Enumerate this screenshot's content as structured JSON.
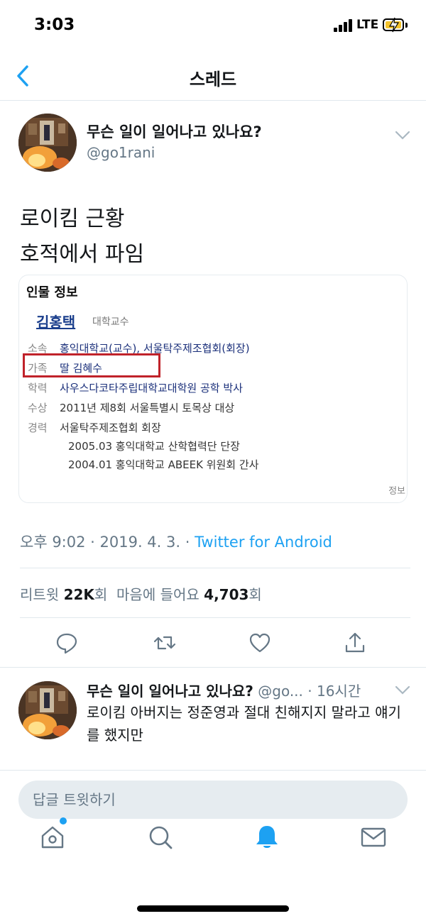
{
  "status_bar": {
    "time": "3:03",
    "network": "LTE"
  },
  "header": {
    "title": "스레드"
  },
  "tweet": {
    "author_name": "무슨 일이 일어나고 있나요?",
    "author_handle": "@go1rani",
    "text_line1": "로이킴 근황",
    "text_line2": "호적에서 파임",
    "timestamp": "오후 9:02 · 2019. 4. 3. · ",
    "source": "Twitter for Android",
    "retweets_label": "리트윗 ",
    "retweets_count": "22K",
    "retweets_unit": "회",
    "likes_label": "마음에 들어요 ",
    "likes_count": "4,703",
    "likes_unit": "회"
  },
  "card": {
    "title": "인물 정보",
    "name": "김홍택",
    "job": "대학교수",
    "rows": [
      {
        "label": "소속",
        "value": "홍익대학교(교수), 서울탁주제조협회(회장)"
      },
      {
        "label": "가족",
        "value": "딸 김혜수"
      },
      {
        "label": "학력",
        "value": "사우스다코타주립대학교대학원 공학 박사"
      },
      {
        "label": "수상",
        "value": "2011년 제8회 서울특별시 토목상 대상"
      },
      {
        "label": "경력",
        "value": "서울탁주제조협회 회장"
      }
    ],
    "career_extra": [
      "2005.03 홍익대학교 산학협력단 단장",
      "2004.01 홍익대학교 ABEEK 위원회 간사"
    ],
    "corner": "정보"
  },
  "reply": {
    "author_name": "무슨 일이 일어나고 있나요?",
    "handle_time": " @go... · 16시간",
    "text": "로이킴 아버지는 정준영과 절대 친해지지 말라고 얘기를 했지만"
  },
  "composer": {
    "placeholder": "답글 트윗하기"
  },
  "icons": {
    "back": "chevron-left-icon",
    "caret": "chevron-down-icon",
    "actions": [
      "reply-icon",
      "retweet-icon",
      "like-icon",
      "share-icon"
    ],
    "tabs": [
      "home-icon",
      "search-icon",
      "notifications-icon",
      "messages-icon"
    ]
  },
  "colors": {
    "accent": "#1da1f2",
    "secondary_text": "#657786",
    "highlight_box": "#c0222a"
  }
}
